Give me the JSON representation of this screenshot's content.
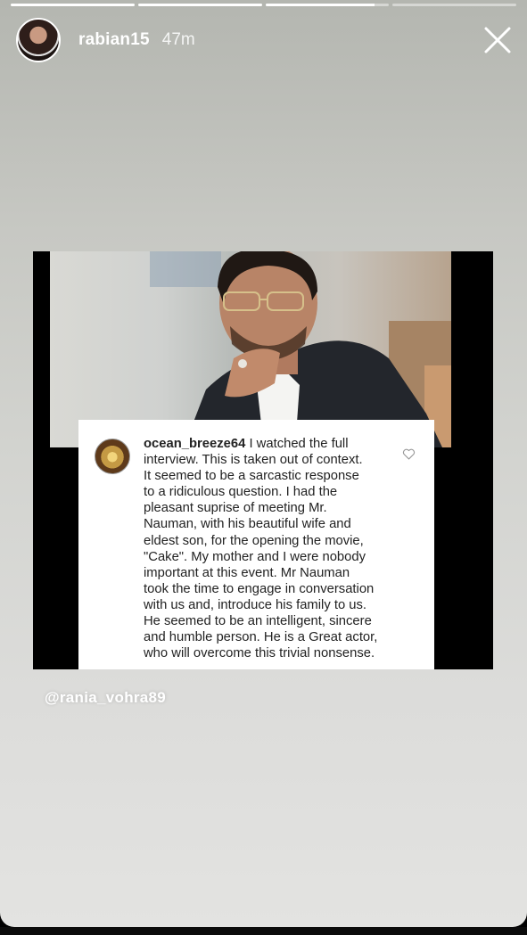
{
  "story": {
    "progress": [
      1,
      1,
      0.88,
      0
    ],
    "user": {
      "username": "rabian15",
      "time": "47m"
    },
    "mention": "@rania_vohra89"
  },
  "post": {
    "comment": {
      "username": "ocean_breeze64",
      "text": " I watched the full\ninterview.  This is taken out of context.\nIt seemed to be a sarcastic response\nto a ridiculous question.  I had the\npleasant suprise of meeting Mr.\nNauman, with his beautiful wife and\neldest son, for the opening the movie,\n\"Cake\". My mother and I were nobody\nimportant at this event.  Mr Nauman\ntook the time to engage in conversation\nwith us and, introduce his family to us.\nHe seemed to be an intelligent, sincere\nand humble person.  He is a Great actor,\nwho will overcome this trivial nonsense."
    }
  },
  "icons": {
    "close": "close-icon",
    "heart": "heart-icon"
  },
  "colors": {
    "story_background": "#c8c9c5",
    "text": "#ffffff",
    "comment_text": "#222222"
  }
}
